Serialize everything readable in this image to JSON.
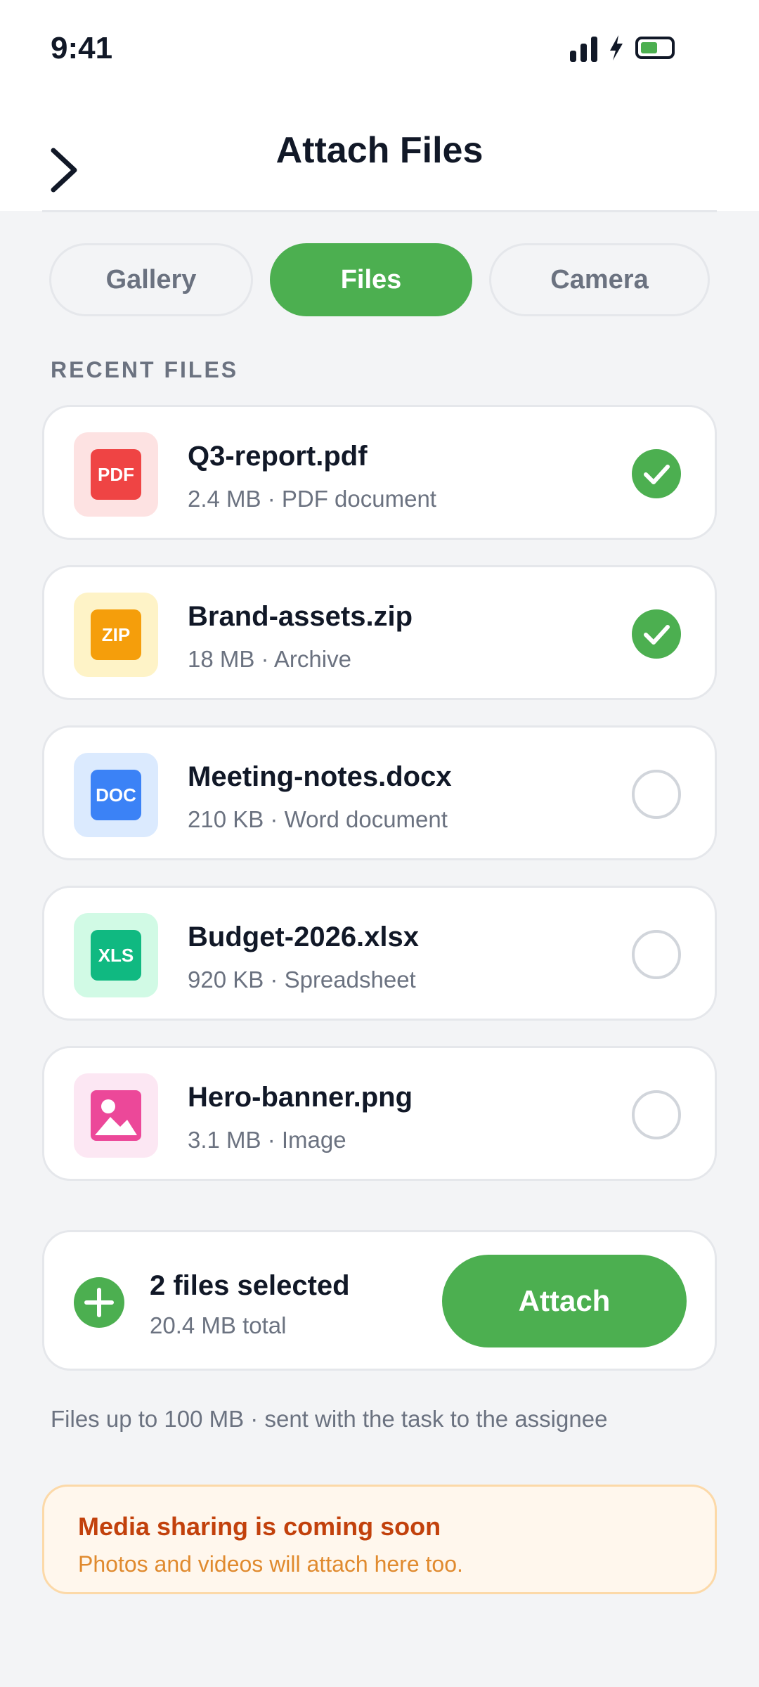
{
  "status_bar": {
    "time": "9:41"
  },
  "header": {
    "title": "Attach Files"
  },
  "tabs": [
    {
      "label": "Gallery",
      "active": false
    },
    {
      "label": "Files",
      "active": true
    },
    {
      "label": "Camera",
      "active": false
    }
  ],
  "section_label": "RECENT FILES",
  "files": [
    {
      "name": "Q3-report.pdf",
      "meta": "2.4 MB · PDF document",
      "badge": "PDF",
      "badge_color": "#ef4444",
      "tile_color": "#fde2e2",
      "selected": true
    },
    {
      "name": "Brand-assets.zip",
      "meta": "18 MB · Archive",
      "badge": "ZIP",
      "badge_color": "#f59e0b",
      "tile_color": "#fef3c7",
      "selected": true
    },
    {
      "name": "Meeting-notes.docx",
      "meta": "210 KB · Word document",
      "badge": "DOC",
      "badge_color": "#3b82f6",
      "tile_color": "#dbeafe",
      "selected": false
    },
    {
      "name": "Budget-2026.xlsx",
      "meta": "920 KB · Spreadsheet",
      "badge": "XLS",
      "badge_color": "#10b981",
      "tile_color": "#d1fae5",
      "selected": false
    },
    {
      "name": "Hero-banner.png",
      "meta": "3.1 MB · Image",
      "icon": "image-icon",
      "badge_color": "#ec4899",
      "tile_color": "#fce7f3",
      "selected": false
    }
  ],
  "summary": {
    "title": "2 files selected",
    "subtitle": "20.4 MB total",
    "attach_label": "Attach"
  },
  "footnote": "Files up to 100 MB · sent with the task to the assignee",
  "notice": {
    "title": "Media sharing is coming soon",
    "subtitle": "Photos and videos will attach here too."
  },
  "colors": {
    "accent": "#4caf50",
    "notice_title": "#c2410c",
    "notice_text": "#e08a2e"
  }
}
